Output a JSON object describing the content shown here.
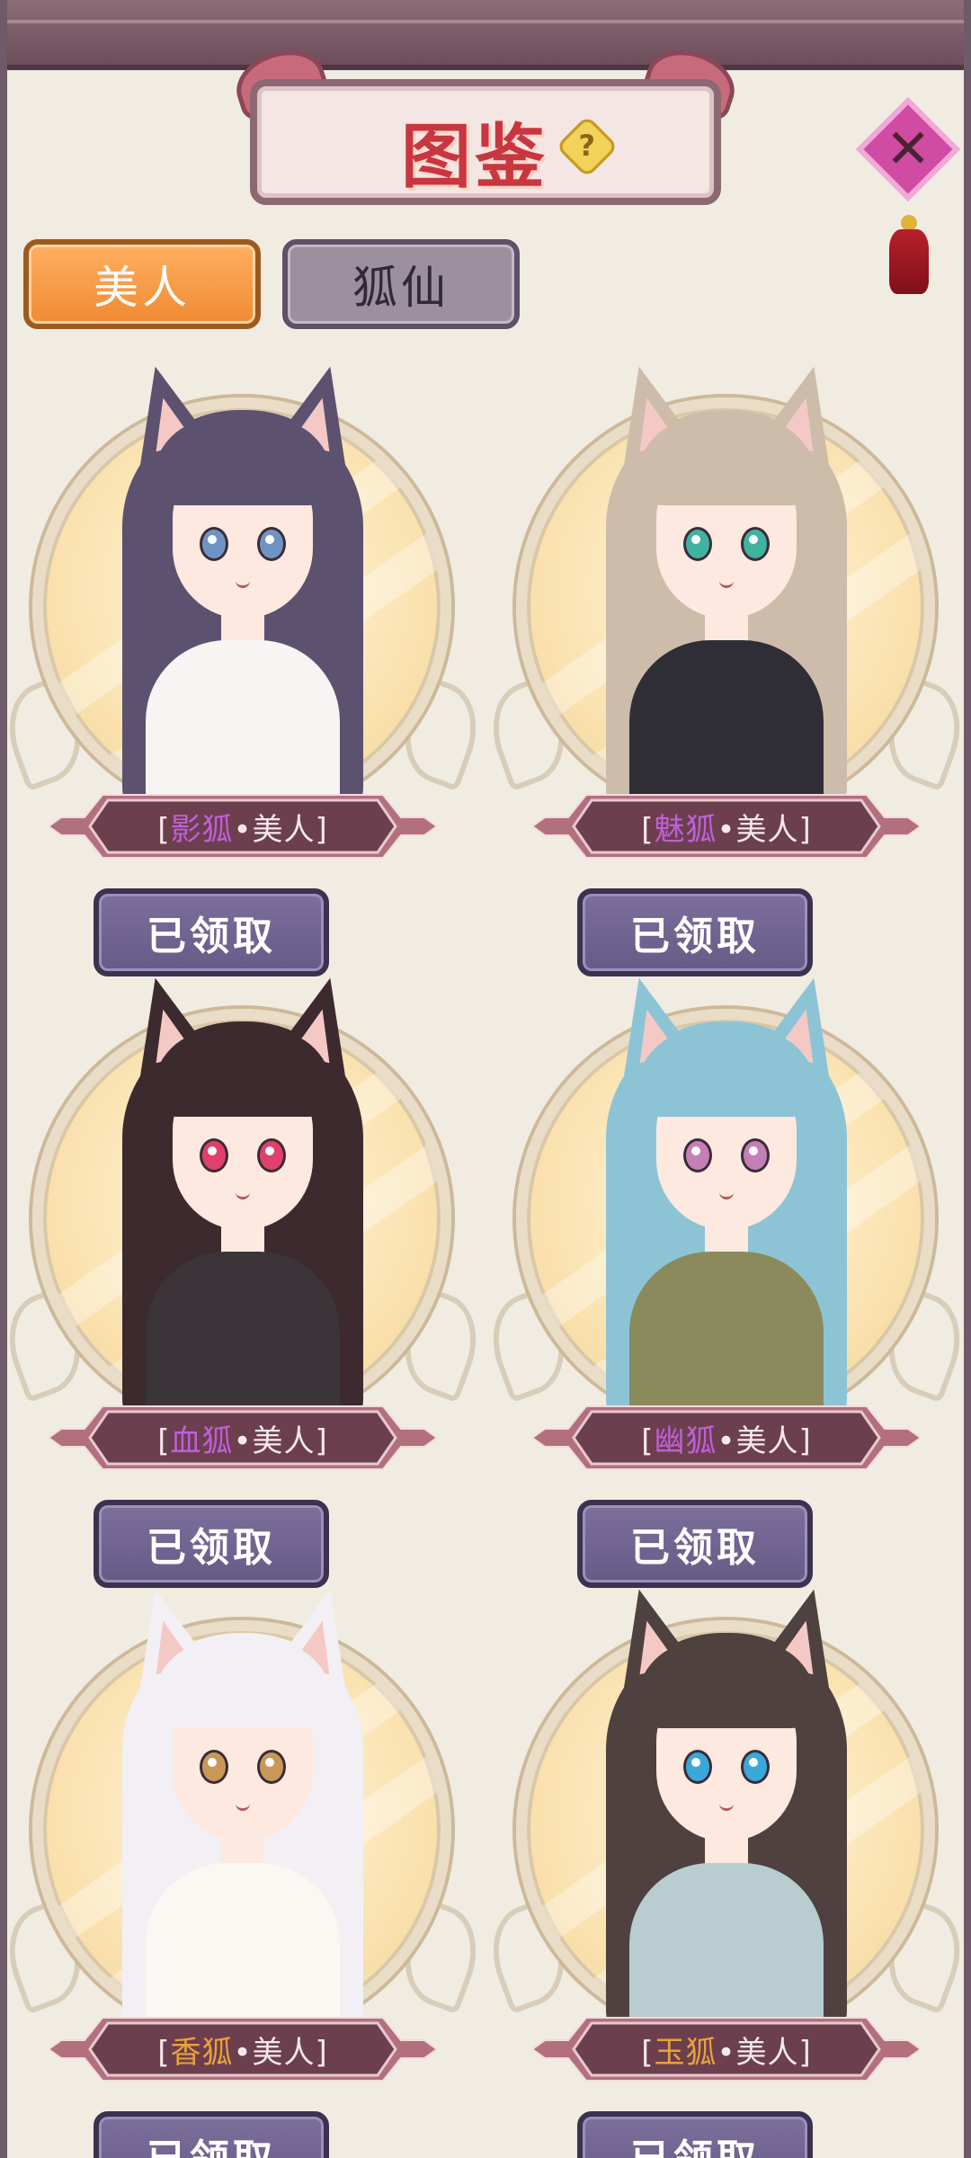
{
  "header": {
    "title": "图鉴",
    "help_icon": "?",
    "close_icon": "✕"
  },
  "tabs": [
    {
      "label": "美人",
      "active": true
    },
    {
      "label": "狐仙",
      "active": false
    }
  ],
  "cards": [
    {
      "open": "[",
      "name": "影狐",
      "sep": "•",
      "title": "美人",
      "close": "]",
      "name_color": "#c05fd8",
      "button": "已领取",
      "hair": "#5d5170",
      "eye": "#6f94c4",
      "cloth": "#f7f4f4"
    },
    {
      "open": "[",
      "name": "魅狐",
      "sep": "•",
      "title": "美人",
      "close": "]",
      "name_color": "#c05fd8",
      "button": "已领取",
      "hair": "#cdbcaa",
      "eye": "#3fb3a0",
      "cloth": "#2f2e37"
    },
    {
      "open": "[",
      "name": "血狐",
      "sep": "•",
      "title": "美人",
      "close": "]",
      "name_color": "#c05fd8",
      "button": "已领取",
      "hair": "#3c2a2e",
      "eye": "#e0406a",
      "cloth": "#3b3438"
    },
    {
      "open": "[",
      "name": "幽狐",
      "sep": "•",
      "title": "美人",
      "close": "]",
      "name_color": "#c05fd8",
      "button": "已领取",
      "hair": "#8cc4d6",
      "eye": "#c47fb4",
      "cloth": "#8a8a5c"
    },
    {
      "open": "[",
      "name": "香狐",
      "sep": "•",
      "title": "美人",
      "close": "]",
      "name_color": "#e9a23b",
      "button": "已领取",
      "hair": "#f2f0f4",
      "eye": "#c99857",
      "cloth": "#fbf7f2"
    },
    {
      "open": "[",
      "name": "玉狐",
      "sep": "•",
      "title": "美人",
      "close": "]",
      "name_color": "#e9a23b",
      "button": "已领取",
      "hair": "#4e413f",
      "eye": "#3aa8d8",
      "cloth": "#b9ccd0"
    }
  ]
}
